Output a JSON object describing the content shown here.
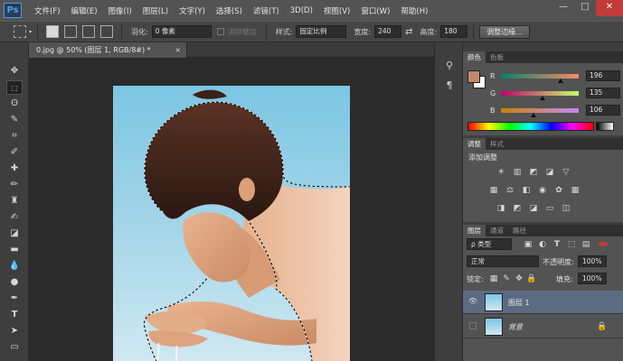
{
  "app": {
    "logo": "Ps"
  },
  "menu": [
    "文件(F)",
    "编辑(E)",
    "图像(I)",
    "图层(L)",
    "文字(Y)",
    "选择(S)",
    "滤镜(T)",
    "3D(D)",
    "视图(V)",
    "窗口(W)",
    "帮助(H)"
  ],
  "window_controls": {
    "minimize": "—",
    "restore": "□",
    "close": "✕"
  },
  "options": {
    "feather_label": "羽化:",
    "feather_value": "0 像素",
    "antialias_label": "消除锯齿",
    "style_label": "样式:",
    "style_value": "固定比例",
    "width_label": "宽度:",
    "width_value": "240",
    "swap_icon": "⇄",
    "height_label": "高度:",
    "height_value": "180",
    "refine_edge_button": "调整边缘..."
  },
  "document": {
    "tab_title": "0.jpg @ 50% (图层 1, RGB/8#) *",
    "close": "×"
  },
  "color_panel": {
    "tabs": [
      "颜色",
      "色板"
    ],
    "channels": [
      {
        "label": "R",
        "value": "196",
        "fraction": 0.77
      },
      {
        "label": "G",
        "value": "135",
        "fraction": 0.53
      },
      {
        "label": "B",
        "value": "106",
        "fraction": 0.42
      }
    ],
    "foreground_color": "#c48769",
    "background_color": "#ffffff"
  },
  "adjustments_panel": {
    "tabs": [
      "调整",
      "样式"
    ],
    "title": "添加调整"
  },
  "layers_panel": {
    "tabs": [
      "图层",
      "通道",
      "路径"
    ],
    "filter_kind": "ρ 类型",
    "blend_mode": "正常",
    "opacity_label": "不透明度:",
    "opacity_value": "100%",
    "lock_label": "锁定:",
    "fill_label": "填充:",
    "fill_value": "100%",
    "layers": [
      {
        "name": "图层 1",
        "visible": true,
        "selected": true
      },
      {
        "name": "背景",
        "visible": false,
        "selected": false
      }
    ]
  },
  "colors": {
    "selection_highlight": "#5c6a82",
    "accent": "#49a1e6"
  }
}
